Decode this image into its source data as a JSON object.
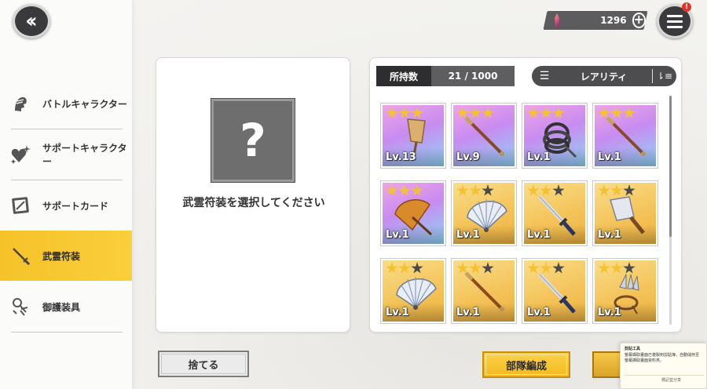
{
  "sidebar": {
    "items": [
      {
        "label": "バトルキャラクター",
        "icon": "battle-character-icon",
        "active": false
      },
      {
        "label": "サポートキャラクター",
        "icon": "support-character-icon",
        "active": false
      },
      {
        "label": "サポートカード",
        "icon": "support-card-icon",
        "active": false
      },
      {
        "label": "武霊符装",
        "icon": "weapon-icon",
        "active": true
      },
      {
        "label": "御護装具",
        "icon": "amulet-icon",
        "active": false
      }
    ]
  },
  "header": {
    "currency_value": "1296",
    "notification_badge": "!"
  },
  "select_panel": {
    "placeholder_glyph": "?",
    "prompt": "武霊符装を選択してください"
  },
  "grid_panel": {
    "owned_label": "所持数",
    "owned_value": "21 / 1000",
    "sort_label": "レアリティ",
    "items": [
      {
        "level": "Lv.13",
        "stars": 3,
        "rarity": 3,
        "art": "folding-fan-icon"
      },
      {
        "level": "Lv.9",
        "stars": 3,
        "rarity": 3,
        "art": "staff-icon"
      },
      {
        "level": "Lv.1",
        "stars": 3,
        "rarity": 3,
        "art": "whip-icon"
      },
      {
        "level": "Lv.1",
        "stars": 3,
        "rarity": 3,
        "art": "staff-icon"
      },
      {
        "level": "Lv.1",
        "stars": 3,
        "rarity": 3,
        "art": "umbrella-icon"
      },
      {
        "level": "Lv.1",
        "stars": 2,
        "rarity": 2,
        "art": "war-fan-icon"
      },
      {
        "level": "Lv.1",
        "stars": 2,
        "rarity": 2,
        "art": "sword-icon"
      },
      {
        "level": "Lv.1",
        "stars": 2,
        "rarity": 2,
        "art": "cleaver-icon"
      },
      {
        "level": "Lv.1",
        "stars": 2,
        "rarity": 2,
        "art": "war-fan-icon"
      },
      {
        "level": "Lv.1",
        "stars": 2,
        "rarity": 2,
        "art": "staff-icon"
      },
      {
        "level": "Lv.1",
        "stars": 2,
        "rarity": 2,
        "art": "sword-icon"
      },
      {
        "level": "Lv.1",
        "stars": 2,
        "rarity": 2,
        "art": "kunai-icon"
      }
    ]
  },
  "buttons": {
    "discard": "捨てる",
    "team_edit": "部隊編成"
  },
  "toast": {
    "title": "剪貼工具",
    "body": "螢幕擷取畫面已複製到剪貼簿，自動儲存至螢幕擷取畫面資料夾。",
    "link": "標記並分享"
  },
  "colors": {
    "active_nav": "#f6c229",
    "rarity3": "#c78cf0",
    "rarity2": "#f4c45a",
    "star_on": "#f3c232"
  }
}
